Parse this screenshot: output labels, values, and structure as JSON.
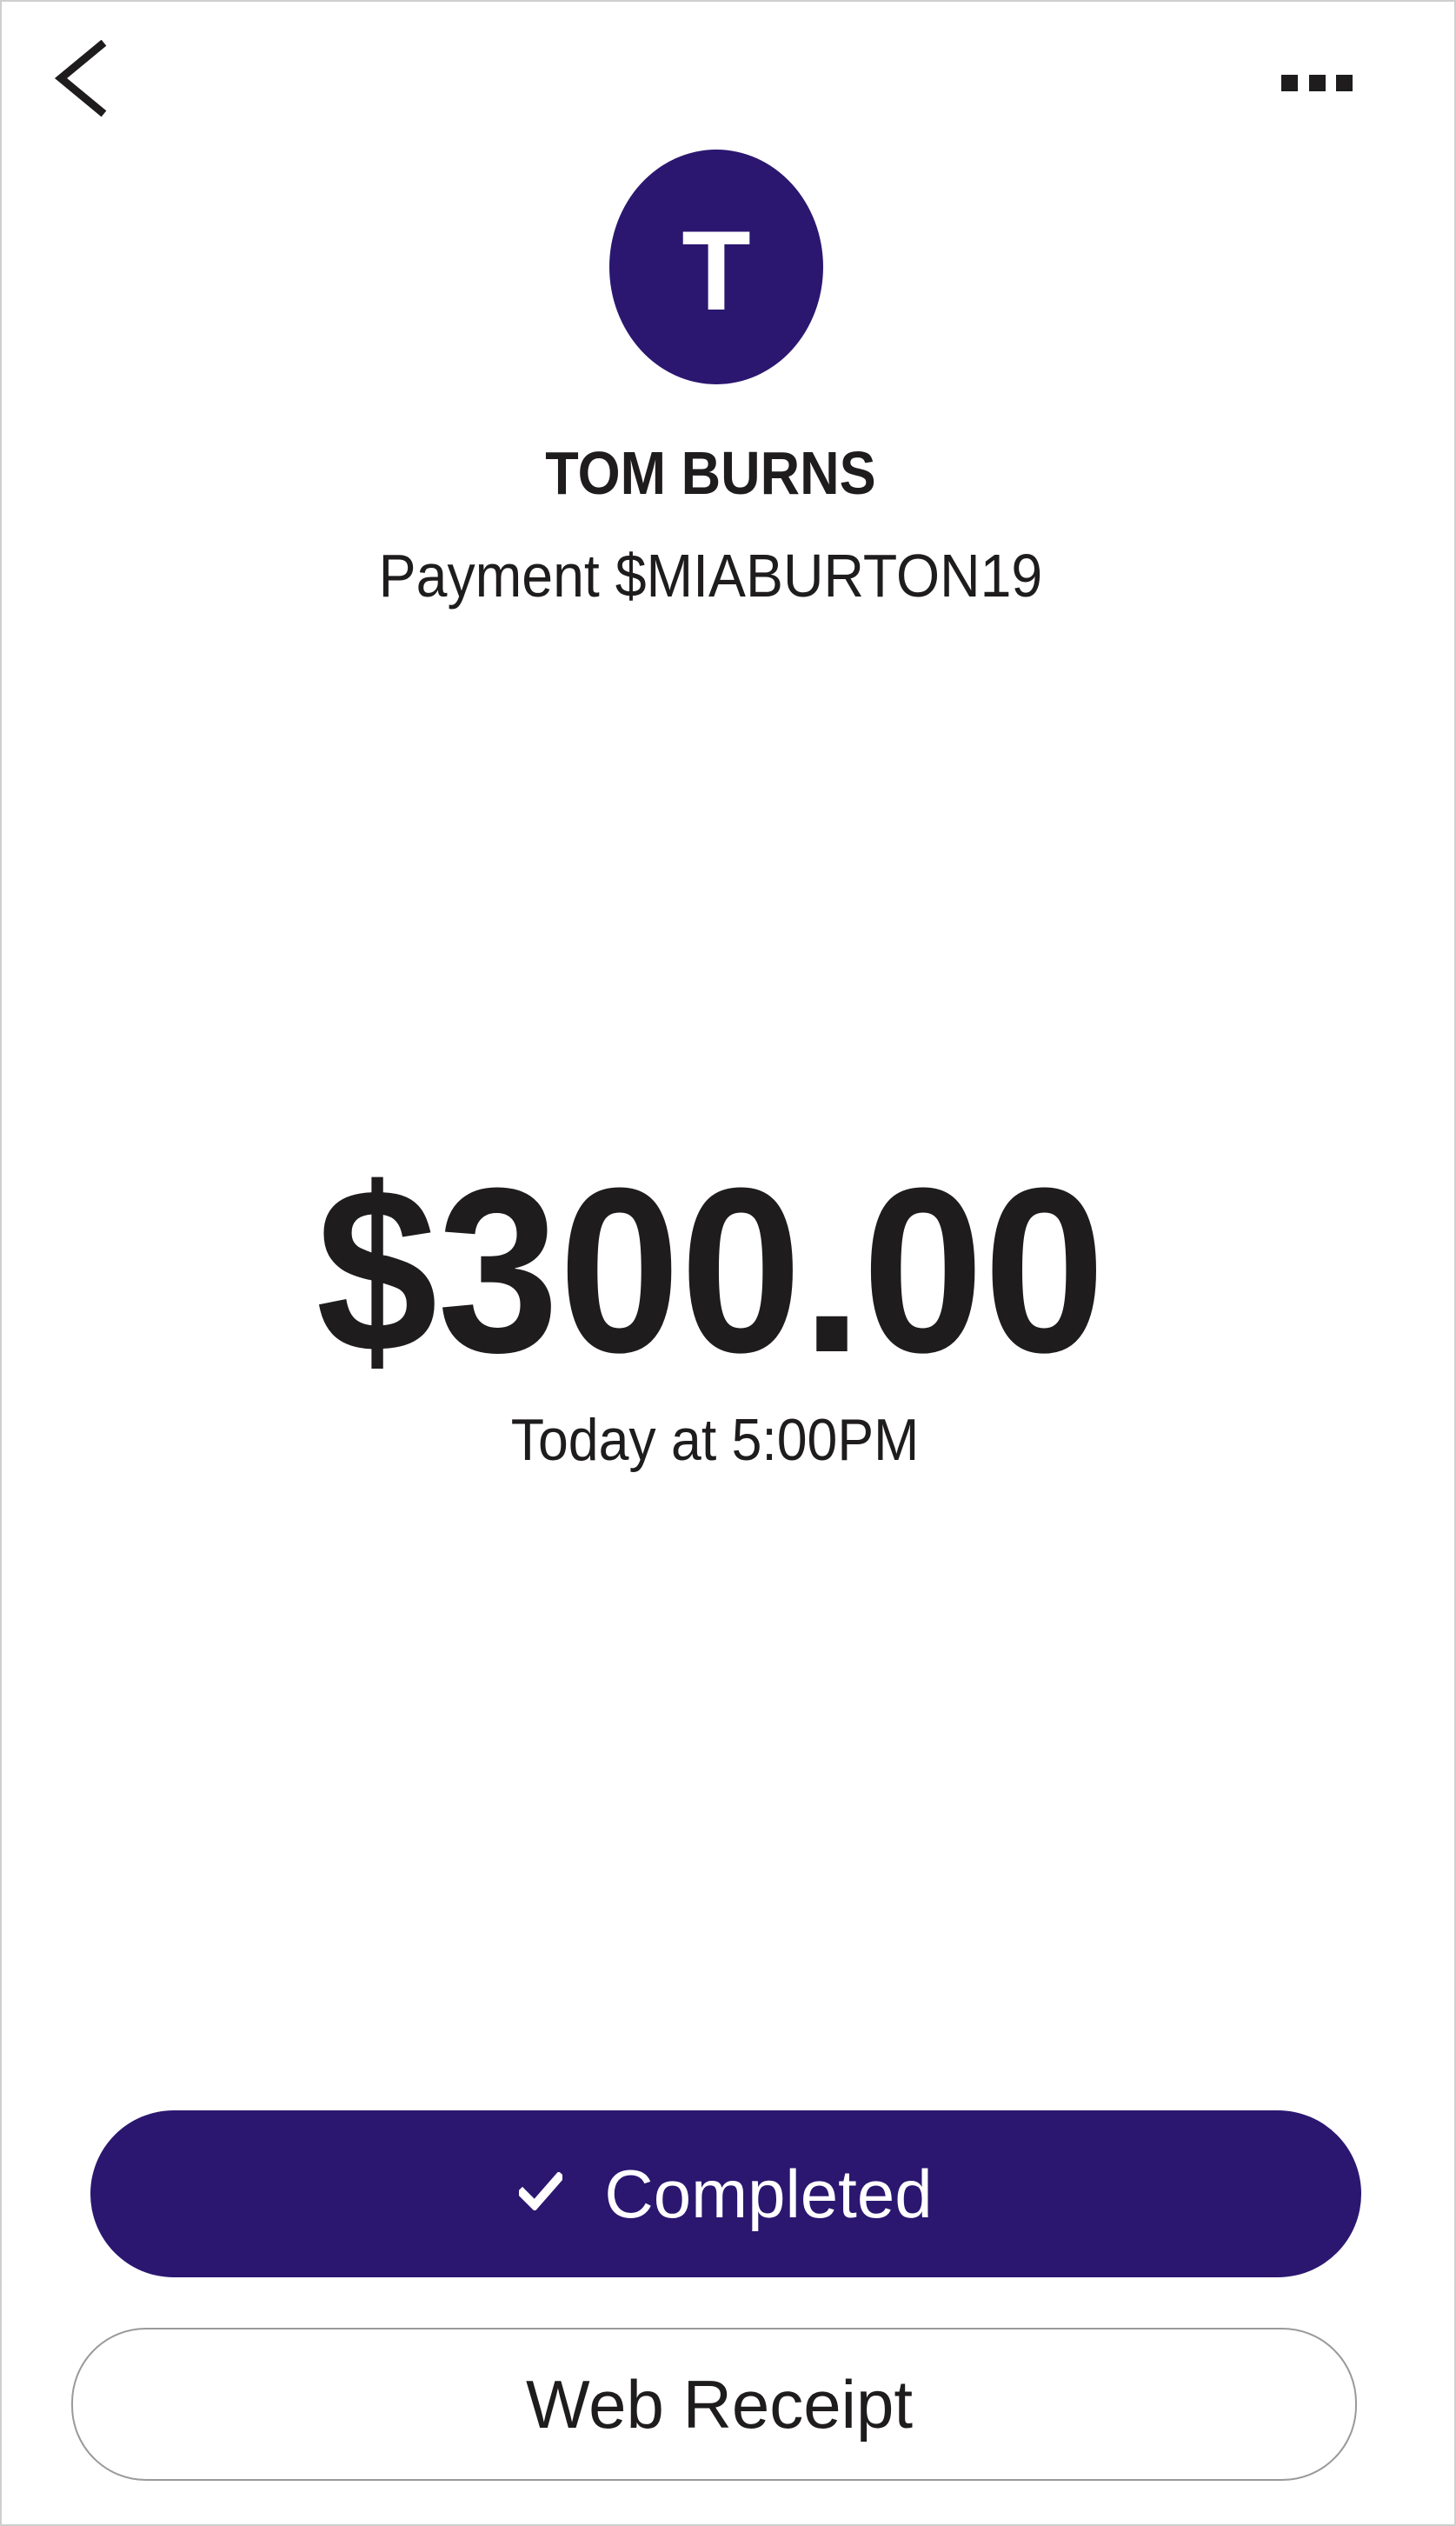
{
  "header": {
    "back_icon": "chevron-left-icon",
    "more_icon": "more-horizontal-icon"
  },
  "payee": {
    "avatar_initial": "T",
    "name": "TOM BURNS",
    "description": "Payment $MIABURTON19"
  },
  "transaction": {
    "amount": "$300.00",
    "timestamp": "Today at 5:00PM"
  },
  "actions": {
    "status_label": "Completed",
    "status_icon": "check-icon",
    "receipt_label": "Web Receipt"
  },
  "colors": {
    "brand": "#2b1770",
    "text": "#1e1c1c",
    "background": "#ffffff"
  }
}
